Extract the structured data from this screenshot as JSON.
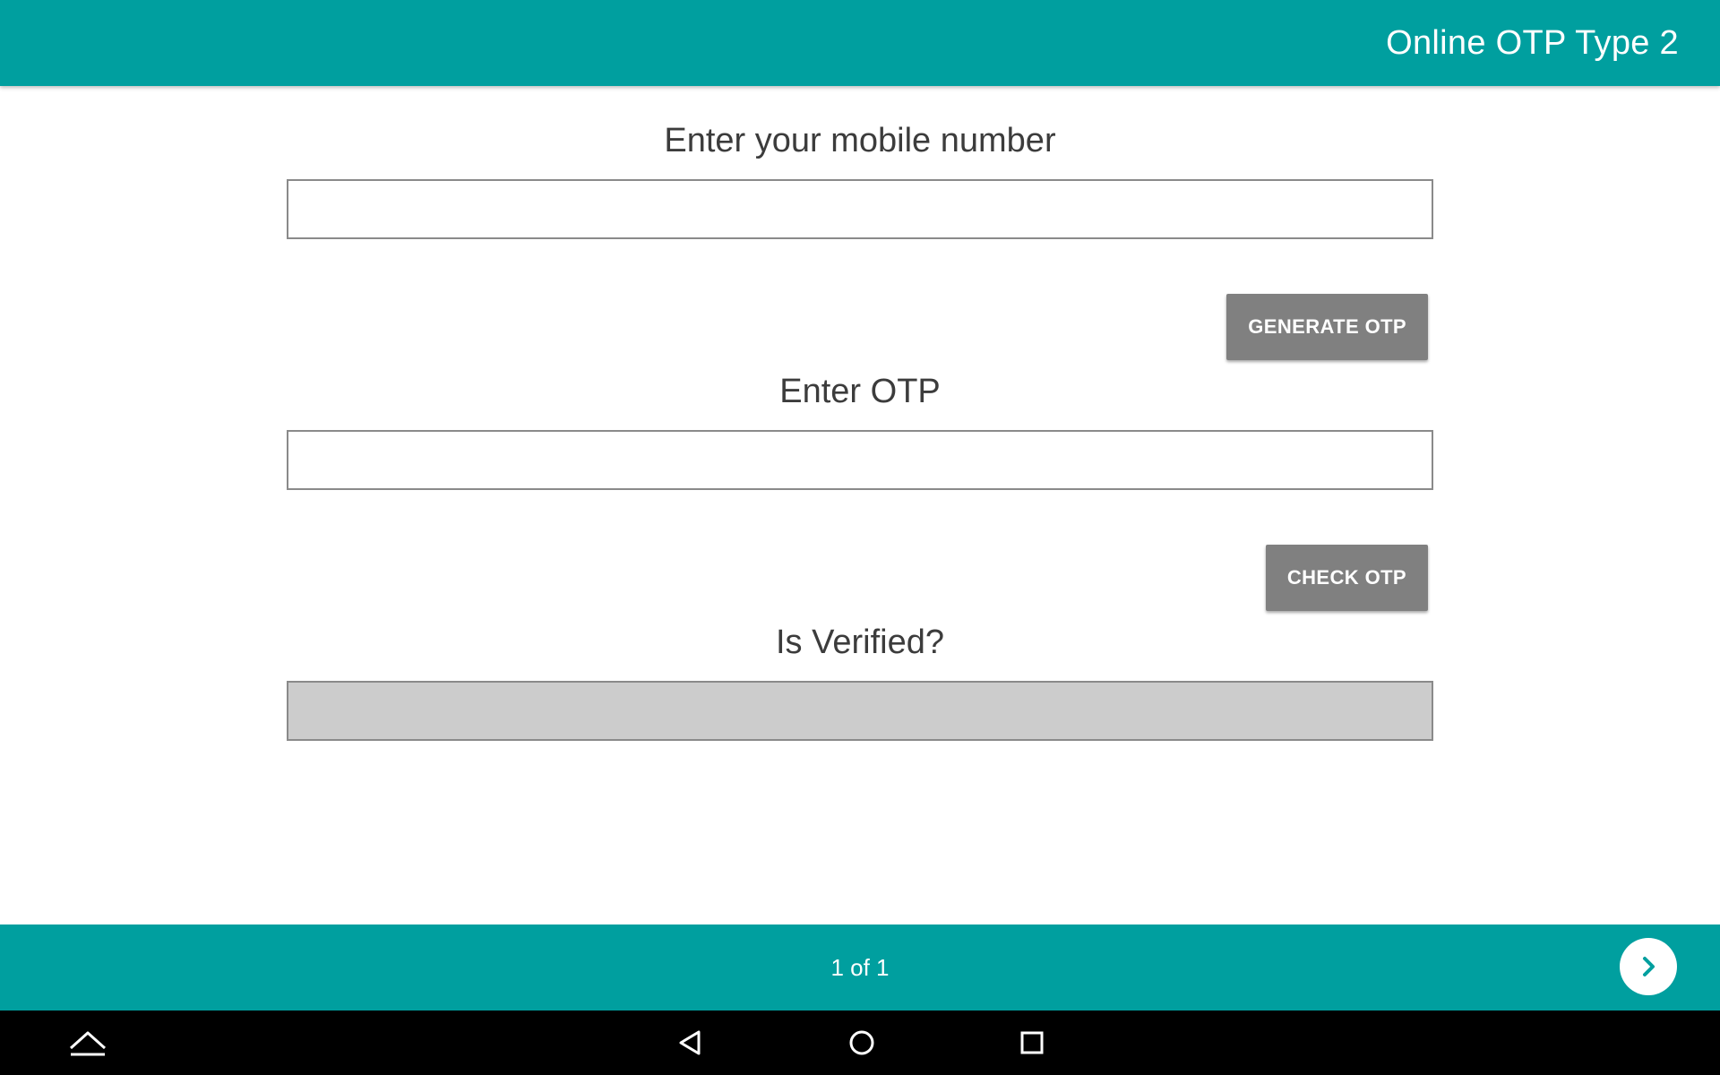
{
  "app_bar": {
    "title": "Online OTP Type 2"
  },
  "form": {
    "mobile": {
      "label": "Enter your mobile number",
      "value": ""
    },
    "generate_button_label": "GENERATE OTP",
    "otp": {
      "label": "Enter OTP",
      "value": ""
    },
    "check_button_label": "CHECK OTP",
    "verified": {
      "label": "Is Verified?",
      "value": ""
    }
  },
  "pager": {
    "text": "1 of 1"
  },
  "icons": {
    "next": "chevron-right-icon",
    "expand": "chevron-up-icon",
    "back": "back-triangle-icon",
    "home": "home-circle-icon",
    "recents": "recents-square-icon"
  },
  "colors": {
    "primary": "#009f9f",
    "button": "#808080",
    "readonly_field": "#cccccc",
    "label_text": "#3c3c3c"
  }
}
